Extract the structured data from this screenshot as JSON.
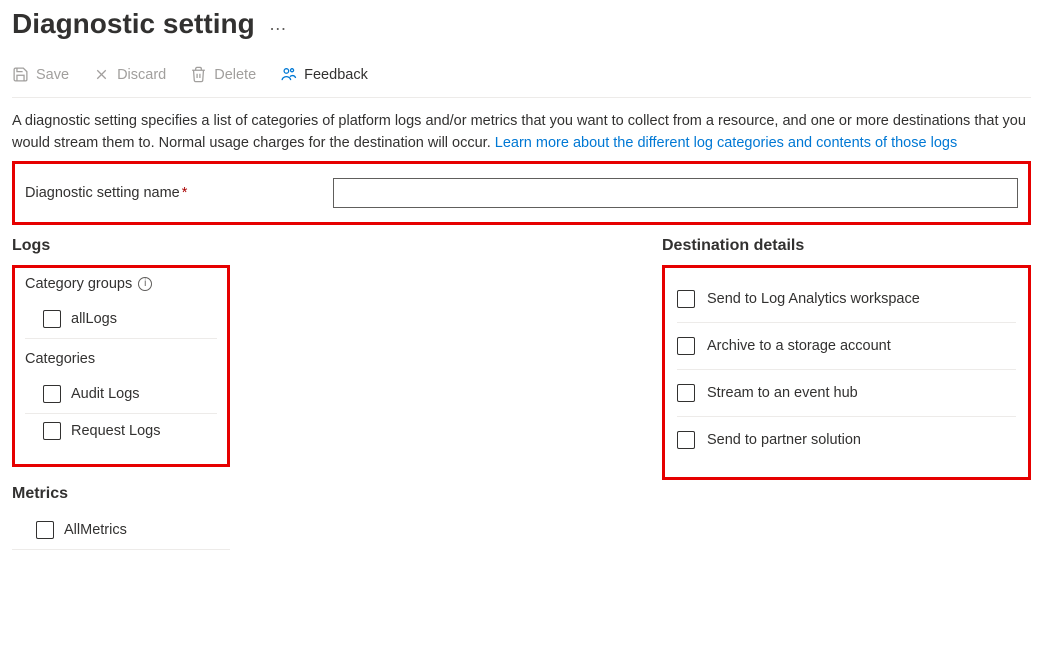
{
  "header": {
    "title": "Diagnostic setting",
    "more": "…"
  },
  "toolbar": {
    "save": "Save",
    "discard": "Discard",
    "delete": "Delete",
    "feedback": "Feedback"
  },
  "description": {
    "text": "A diagnostic setting specifies a list of categories of platform logs and/or metrics that you want to collect from a resource, and one or more destinations that you would stream them to. Normal usage charges for the destination will occur. ",
    "link": "Learn more about the different log categories and contents of those logs"
  },
  "name_field": {
    "label": "Diagnostic setting name",
    "required_mark": "*",
    "value": ""
  },
  "logs": {
    "title": "Logs",
    "category_groups_label": "Category groups",
    "all_logs": "allLogs",
    "categories_label": "Categories",
    "audit_logs": "Audit Logs",
    "request_logs": "Request Logs"
  },
  "metrics": {
    "title": "Metrics",
    "all_metrics": "AllMetrics"
  },
  "destinations": {
    "title": "Destination details",
    "log_analytics": "Send to Log Analytics workspace",
    "storage": "Archive to a storage account",
    "event_hub": "Stream to an event hub",
    "partner": "Send to partner solution"
  }
}
